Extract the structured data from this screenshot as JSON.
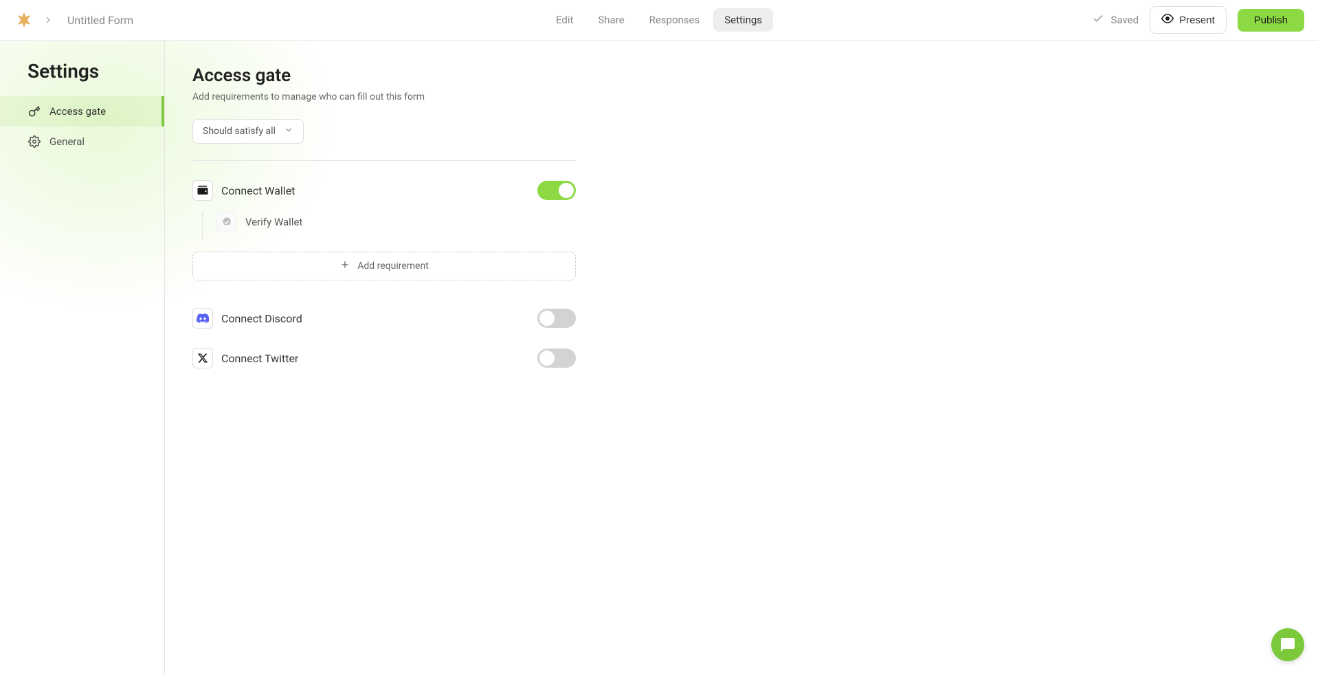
{
  "header": {
    "form_title": "Untitled Form",
    "tabs": [
      {
        "label": "Edit"
      },
      {
        "label": "Share"
      },
      {
        "label": "Responses"
      },
      {
        "label": "Settings"
      }
    ],
    "saved_label": "Saved",
    "present_label": "Present",
    "publish_label": "Publish"
  },
  "sidebar": {
    "title": "Settings",
    "items": [
      {
        "label": "Access gate"
      },
      {
        "label": "General"
      }
    ]
  },
  "page": {
    "title": "Access gate",
    "subtitle": "Add requirements to manage who can fill out this form",
    "satisfy_label": "Should satisfy all",
    "add_requirement_label": "Add requirement"
  },
  "requirements": {
    "wallet": {
      "label": "Connect Wallet",
      "enabled": true,
      "sub": {
        "label": "Verify Wallet"
      }
    },
    "discord": {
      "label": "Connect Discord",
      "enabled": false
    },
    "twitter": {
      "label": "Connect Twitter",
      "enabled": false
    }
  },
  "colors": {
    "accent": "#8cd944",
    "discord": "#5865F2"
  }
}
